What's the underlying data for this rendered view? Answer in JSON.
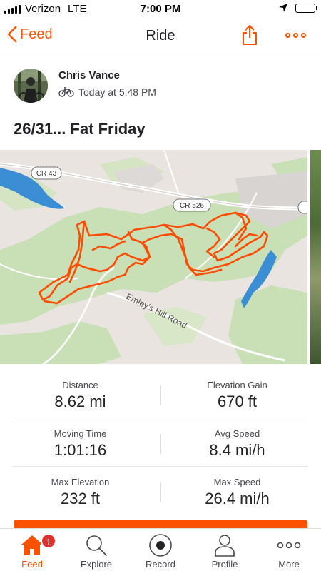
{
  "status_bar": {
    "carrier": "Verizon",
    "network": "LTE",
    "time": "7:00 PM"
  },
  "nav": {
    "back_label": "Feed",
    "title": "Ride"
  },
  "athlete": {
    "name": "Chris Vance",
    "activity_icon": "bike-icon",
    "timestamp": "Today at 5:48 PM"
  },
  "activity": {
    "title": "26/31... Fat Friday"
  },
  "map": {
    "road_labels": [
      "CR 43",
      "CR 526",
      "Emley's Hill Road"
    ],
    "route_color": "#fc4c02"
  },
  "stats": [
    {
      "left": {
        "label": "Distance",
        "value": "8.62 mi"
      },
      "right": {
        "label": "Elevation Gain",
        "value": "670 ft"
      }
    },
    {
      "left": {
        "label": "Moving Time",
        "value": "1:01:16"
      },
      "right": {
        "label": "Avg Speed",
        "value": "8.4 mi/h"
      }
    },
    {
      "left": {
        "label": "Max Elevation",
        "value": "232 ft"
      },
      "right": {
        "label": "Max Speed",
        "value": "26.4 mi/h"
      }
    }
  ],
  "tabbar": {
    "tabs": [
      {
        "label": "Feed",
        "icon": "home-icon",
        "active": true,
        "badge": "1"
      },
      {
        "label": "Explore",
        "icon": "search-icon"
      },
      {
        "label": "Record",
        "icon": "record-icon"
      },
      {
        "label": "Profile",
        "icon": "profile-icon"
      },
      {
        "label": "More",
        "icon": "more-icon"
      }
    ]
  },
  "colors": {
    "accent": "#fc5200",
    "badge": "#e0312e",
    "water": "#3a8fd6",
    "park": "#c8dfb5"
  }
}
